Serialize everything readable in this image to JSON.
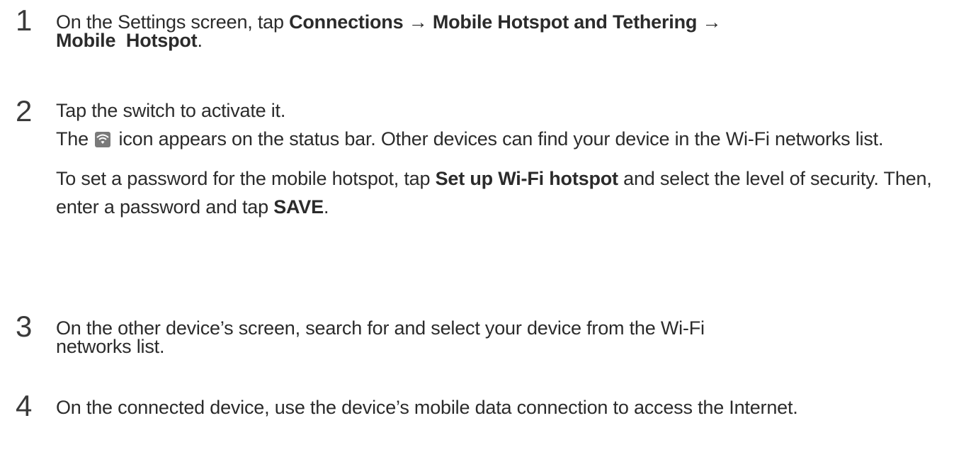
{
  "steps": [
    {
      "number": "1",
      "text_1": "On the Settings screen, tap ",
      "bold_1": "Connections",
      "arrow_1": " → ",
      "bold_2": "Mobile Hotspot and Tethering",
      "arrow_2": " →",
      "bold_3": "Mobile  Hotspot",
      "text_end": "."
    },
    {
      "number": "2",
      "line_1": "Tap the switch to activate it.",
      "para_2_pre": "The ",
      "icon": "wifi-hotspot-icon",
      "para_2_post": " icon appears on the status bar. Other devices can find your device in the Wi-Fi  networks list.",
      "para_3_pre": "To set a password for the mobile hotspot, tap ",
      "para_3_bold_1": "Set up Wi-Fi hotspot",
      "para_3_mid": " and select the level of  security. Then, enter a password and tap ",
      "para_3_bold_2": "SAVE",
      "para_3_end": "."
    },
    {
      "number": "3",
      "text": "On the other device’s screen, search for and select your device from the Wi-Fi networks  list."
    },
    {
      "number": "4",
      "text": "On the connected device, use the device’s mobile data connection to access the Internet."
    }
  ],
  "colors": {
    "text": "#2b2b2b",
    "number": "#3a3a3a",
    "icon_bg": "#7a7a7a"
  }
}
